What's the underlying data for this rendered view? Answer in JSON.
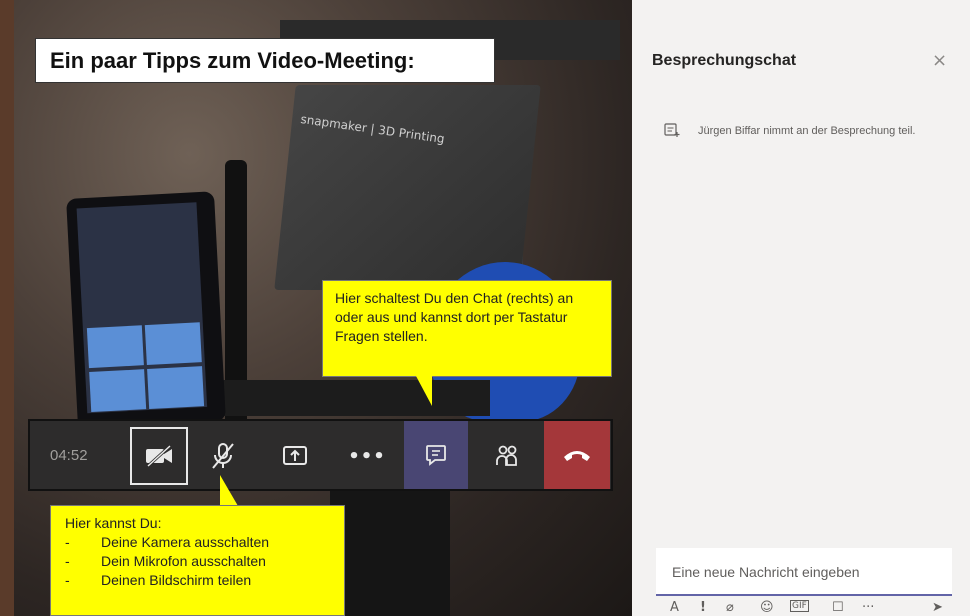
{
  "overlay": {
    "heading": "Ein paar Tipps zum Video-Meeting:"
  },
  "toolbar": {
    "timer": "04:52",
    "buttons": [
      {
        "name": "camera-off-icon"
      },
      {
        "name": "mic-off-icon"
      },
      {
        "name": "share-screen-icon"
      },
      {
        "name": "more-icon"
      },
      {
        "name": "chat-icon"
      },
      {
        "name": "participants-icon"
      },
      {
        "name": "hangup-icon"
      }
    ],
    "more_glyph": "•••",
    "hangup_color": "#a4373a",
    "chat_active_color": "#494673"
  },
  "callouts": {
    "chat": "Hier schaltest Du den Chat (rechts) an oder aus und kannst dort per Tastatur Fragen stellen.",
    "camera_intro": "Hier kannst Du:",
    "camera_items": [
      {
        "dash": "-",
        "text": "Deine Kamera ausschalten"
      },
      {
        "dash": "-",
        "text": "Dein Mikrofon ausschalten"
      },
      {
        "dash": "-",
        "text": "Deinen Bildschirm teilen"
      }
    ],
    "color": "#ffff00"
  },
  "chat_panel": {
    "title": "Besprechungschat",
    "close": "×",
    "message": "Jürgen Biffar nimmt an der Besprechung teil.",
    "input_placeholder": "Eine neue Nachricht eingeben",
    "tools": [
      "A",
      "!",
      "⌀",
      "☺",
      "GIF",
      "☐",
      "···",
      "➤"
    ]
  },
  "video": {
    "device_label": "snapmaker | 3D Printing"
  }
}
